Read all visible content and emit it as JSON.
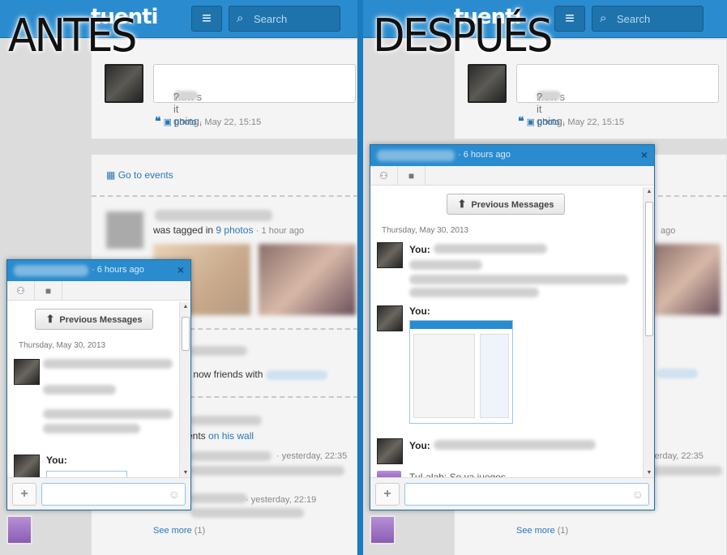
{
  "brand": {
    "logo_text": "tuenti",
    "accent": "#2a8ccf"
  },
  "topbar": {
    "menu_icon": "menu-icon",
    "search_placeholder": "Search"
  },
  "labels": {
    "before": "ANTES",
    "after": "DESPUÉS"
  },
  "status_box": {
    "prompt": "How's it going,",
    "prompt_end": "?",
    "photo_label": "photo",
    "separator": "·",
    "date": "May 22, 15:15"
  },
  "events": {
    "go_to_events": "Go to events"
  },
  "feed": {
    "tagged_text": "was tagged in",
    "tagged_link": "9 photos",
    "tagged_time": "1 hour ago",
    "friends_text": "s now friends with",
    "wall_text": "ents",
    "wall_link": "on his wall",
    "time_yesterday_1": "yesterday, 22:35",
    "time_yesterday_2": "yesterday, 22:19",
    "see_more": "See more",
    "see_more_count": "(1)",
    "right_time_1": "ago",
    "right_time_2": "sterday, 22:35"
  },
  "chat": {
    "time_ago": "6 hours ago",
    "close": "×",
    "previous_messages": "Previous Messages",
    "date": "Thursday, May 30, 2013",
    "you_label": "You:",
    "tuenti_label": "TuLalah: So ya juegos",
    "add_label": "+",
    "smiley": "☺"
  }
}
